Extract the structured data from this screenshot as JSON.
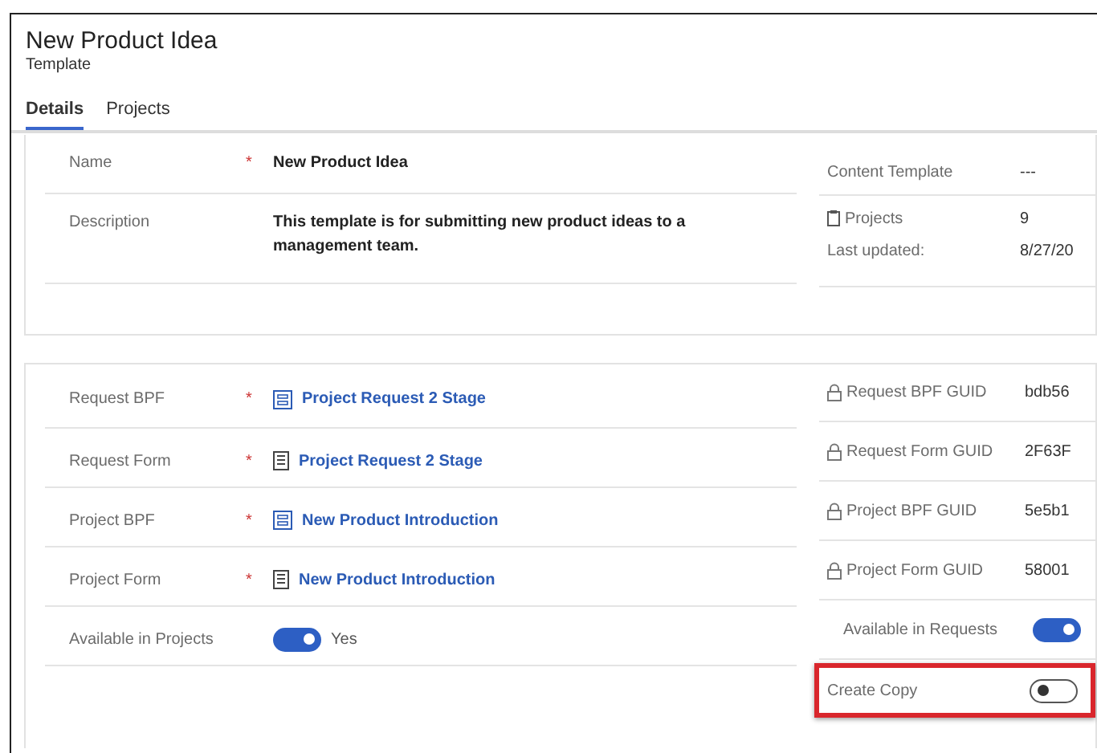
{
  "header": {
    "title": "New Product Idea",
    "subtitle": "Template"
  },
  "tabs": [
    {
      "label": "Details",
      "selected": true
    },
    {
      "label": "Projects",
      "selected": false
    }
  ],
  "general": {
    "fields": [
      {
        "label": "Name",
        "marker": "*",
        "value": "New Product Idea"
      },
      {
        "label": "Description",
        "value": "This template is for submitting new product ideas to a management team."
      }
    ],
    "info": [
      {
        "label": "Content Template",
        "icon": false,
        "value": "---"
      },
      {
        "label": "Projects",
        "icon": true,
        "value": "9"
      },
      {
        "label": "Last updated:",
        "icon": false,
        "value": "8/27/20"
      }
    ]
  },
  "process": {
    "fields": [
      {
        "kind": "process",
        "label": "Request BPF",
        "marker": "*",
        "value": "Project Request 2 Stage"
      },
      {
        "kind": "form",
        "label": "Request Form",
        "marker": "*",
        "value": "Project Request 2 Stage"
      },
      {
        "kind": "process",
        "label": "Project BPF",
        "marker": "*",
        "value": "New Product Introduction"
      },
      {
        "kind": "form",
        "label": "Project Form",
        "marker": "*",
        "value": "New Product Introduction"
      },
      {
        "kind": "toggle",
        "label": "Available in Projects",
        "on": true,
        "value": "Yes"
      }
    ],
    "guids": [
      {
        "kind": "locked",
        "label": "Request BPF GUID",
        "value": "bdb56"
      },
      {
        "kind": "locked",
        "label": "Request Form GUID",
        "value": "2F63F"
      },
      {
        "kind": "locked",
        "label": "Project BPF GUID",
        "value": "5e5b1"
      },
      {
        "kind": "locked",
        "label": "Project Form GUID",
        "value": "58001"
      },
      {
        "kind": "toggle",
        "label": "Available in Requests",
        "on": true,
        "highlighted": false
      },
      {
        "kind": "toggle",
        "label": "Create Copy",
        "on": false,
        "highlighted": true
      }
    ]
  }
}
